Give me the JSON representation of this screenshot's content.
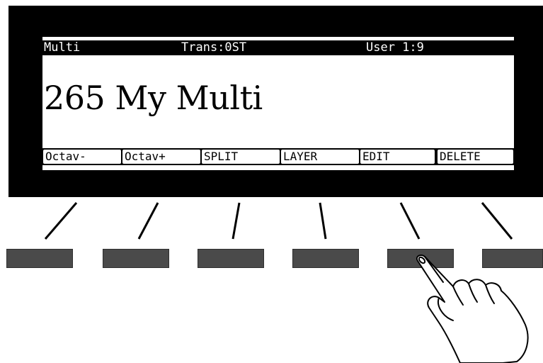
{
  "display": {
    "mode": "Multi",
    "transpose": "Trans:0ST",
    "bank": "User 1:9",
    "program_number": "265",
    "program_name": "My Multi",
    "program_title": "265 My Multi"
  },
  "softkeys": [
    {
      "label": "Octav-"
    },
    {
      "label": "Octav+"
    },
    {
      "label": "SPLIT"
    },
    {
      "label": "LAYER"
    },
    {
      "label": "EDIT"
    },
    {
      "label": "DELETE"
    }
  ],
  "colors": {
    "bezel": "#000000",
    "button": "#4a4a4a",
    "lcd_background": "#ffffff"
  },
  "pressed_button": "EDIT",
  "icons": {
    "pointer": "pointing-hand-icon"
  }
}
